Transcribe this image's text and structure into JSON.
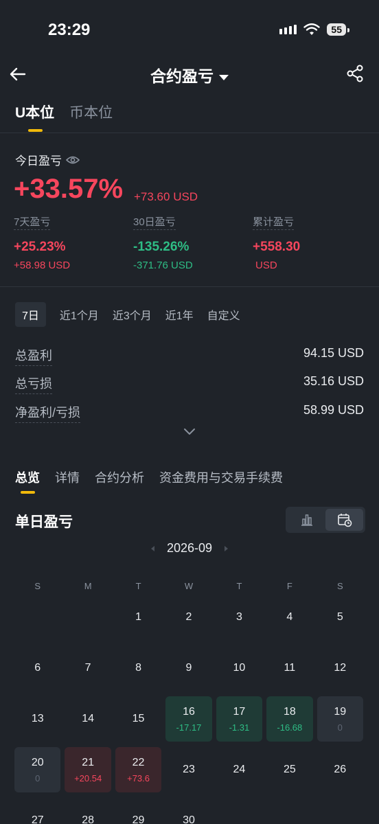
{
  "status": {
    "time": "23:29",
    "battery": "55"
  },
  "nav": {
    "title": "合约盈亏"
  },
  "unit_tabs": [
    {
      "label": "U本位"
    },
    {
      "label": "币本位"
    }
  ],
  "today": {
    "label": "今日盈亏",
    "pct": "+33.57%",
    "usd": "+73.60 USD"
  },
  "stats": [
    {
      "label": "7天盈亏",
      "pct": "+25.23%",
      "usd": "+58.98 USD"
    },
    {
      "label": "30日盈亏",
      "pct": "-135.26%",
      "usd": "-371.76 USD"
    },
    {
      "label": "累计盈亏",
      "pct": "+558.30",
      "usd": "USD"
    }
  ],
  "range_tabs": [
    {
      "label": "7日"
    },
    {
      "label": "近1个月"
    },
    {
      "label": "近3个月"
    },
    {
      "label": "近1年"
    },
    {
      "label": "自定义"
    }
  ],
  "summary": [
    {
      "label": "总盈利",
      "value": "94.15 USD"
    },
    {
      "label": "总亏损",
      "value": "35.16 USD"
    },
    {
      "label": "净盈利/亏损",
      "value": "58.99 USD"
    }
  ],
  "sub_tabs": [
    {
      "label": "总览"
    },
    {
      "label": "详情"
    },
    {
      "label": "合约分析"
    },
    {
      "label": "资金费用与交易手续费"
    }
  ],
  "daily": {
    "title": "单日盈亏",
    "month": "2026-09"
  },
  "weekdays": [
    "S",
    "M",
    "T",
    "W",
    "T",
    "F",
    "S"
  ],
  "calendar": [
    {
      "day": "",
      "pnl": "",
      "kind": "empty"
    },
    {
      "day": "",
      "pnl": "",
      "kind": "empty"
    },
    {
      "day": "1",
      "pnl": "",
      "kind": "none"
    },
    {
      "day": "2",
      "pnl": "",
      "kind": "none"
    },
    {
      "day": "3",
      "pnl": "",
      "kind": "none"
    },
    {
      "day": "4",
      "pnl": "",
      "kind": "none"
    },
    {
      "day": "5",
      "pnl": "",
      "kind": "none"
    },
    {
      "day": "6",
      "pnl": "",
      "kind": "none"
    },
    {
      "day": "7",
      "pnl": "",
      "kind": "none"
    },
    {
      "day": "8",
      "pnl": "",
      "kind": "none"
    },
    {
      "day": "9",
      "pnl": "",
      "kind": "none"
    },
    {
      "day": "10",
      "pnl": "",
      "kind": "none"
    },
    {
      "day": "11",
      "pnl": "",
      "kind": "none"
    },
    {
      "day": "12",
      "pnl": "",
      "kind": "none"
    },
    {
      "day": "13",
      "pnl": "",
      "kind": "none"
    },
    {
      "day": "14",
      "pnl": "",
      "kind": "none"
    },
    {
      "day": "15",
      "pnl": "",
      "kind": "none"
    },
    {
      "day": "16",
      "pnl": "-17.17",
      "kind": "neg"
    },
    {
      "day": "17",
      "pnl": "-1.31",
      "kind": "neg"
    },
    {
      "day": "18",
      "pnl": "-16.68",
      "kind": "neg"
    },
    {
      "day": "19",
      "pnl": "0",
      "kind": "zero"
    },
    {
      "day": "20",
      "pnl": "0",
      "kind": "zero"
    },
    {
      "day": "21",
      "pnl": "+20.54",
      "kind": "pos"
    },
    {
      "day": "22",
      "pnl": "+73.6",
      "kind": "pos"
    },
    {
      "day": "23",
      "pnl": "",
      "kind": "none"
    },
    {
      "day": "24",
      "pnl": "",
      "kind": "none"
    },
    {
      "day": "25",
      "pnl": "",
      "kind": "none"
    },
    {
      "day": "26",
      "pnl": "",
      "kind": "none"
    },
    {
      "day": "27",
      "pnl": "",
      "kind": "none"
    },
    {
      "day": "28",
      "pnl": "",
      "kind": "none"
    },
    {
      "day": "29",
      "pnl": "",
      "kind": "none"
    },
    {
      "day": "30",
      "pnl": "",
      "kind": "none"
    }
  ],
  "colors": {
    "accent": "#f0b90b",
    "profit": "#f6465d",
    "loss": "#2ebd85",
    "background": "#1f2329"
  }
}
